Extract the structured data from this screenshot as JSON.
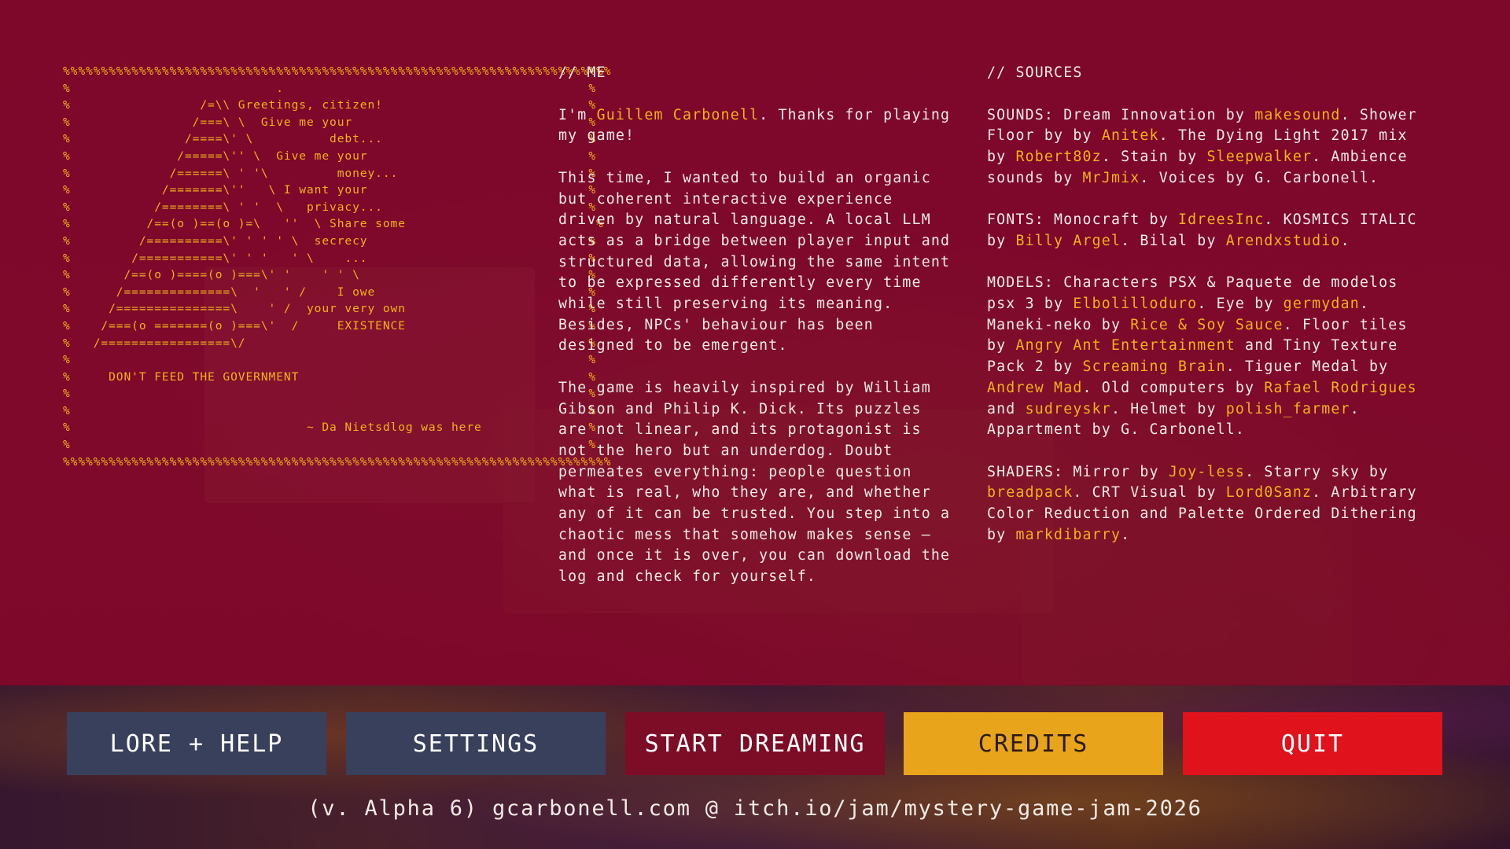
{
  "ascii_art": "%%%%%%%%%%%%%%%%%%%%%%%%%%%%%%%%%%%%%%%%%%%%%%%%%%%%%%%%%%%%%%%%%%%%%%%%\n%                           .                                        %\n%                 /=\\\\ Greetings, citizen!                           %\n%                /===\\ \\  Give me your                               %\n%               /====\\' \\          debt...                           %\n%              /=====\\'' \\  Give me your                             %\n%             /======\\ ' '\\         money...                         %\n%            /=======\\''   \\ I want your                             %\n%           /========\\ ' '  \\   privacy...                           %\n%          /==(o )==(o )=\\   ''  \\ Share some                         %\n%         /==========\\' ' ' ' \\  secrecy                             %\n%        /===========\\' ' '   ' \\    ...                             %\n%       /==(o )====(o )===\\' '    ' ' \\                              %\n%      /==============\\  '   ' /    I owe                            %\n%     /===============\\    ' /  your very own                        %\n%    /===(o =======(o )===\\'  /     EXISTENCE                        %\n%   /=================\\/                                             %\n%                                                                    %\n%     DON'T FEED THE GOVERNMENT                                      %\n%                                                                    %\n%                                                                    %\n%                               ~ Da Nietsdlog was here              %\n%                                                                    %\n%%%%%%%%%%%%%%%%%%%%%%%%%%%%%%%%%%%%%%%%%%%%%%%%%%%%%%%%%%%%%%%%%%%%%%%%",
  "me": {
    "heading": "// ME",
    "p1": {
      "a": "I'm ",
      "name": "Guillem Carbonell",
      "b": ". Thanks for playing my game!"
    },
    "p2": "This time, I wanted to build an organic but coherent interactive experience driven by natural language. A local LLM acts as a bridge between player input and structured data, allowing the same intent to be expressed differently every time while still preserving its meaning. Besides, NPCs' behaviour has been designed to be emergent.",
    "p3": "The game is heavily inspired by William Gibson and Philip K. Dick. Its puzzles are not linear, and its protagonist is not the hero but an underdog. Doubt permeates everything: people question what is real, who they are, and whether any of it can be trusted. You step into a chaotic mess that somehow makes sense — and once it is over, you can download the log and check for yourself."
  },
  "sources": {
    "heading": "// SOURCES",
    "sounds": {
      "t1": "SOUNDS: Dream Innovation by ",
      "l1": "makesound",
      "t2": ". Shower Floor by by ",
      "l2": "Anitek",
      "t3": ". The Dying Light 2017 mix by ",
      "l3": "Robert80z",
      "t4": ". Stain by ",
      "l4": "Sleepwalker",
      "t5": ". Ambience sounds by ",
      "l5": "MrJmix",
      "t6": ". Voices by G. Carbonell."
    },
    "fonts": {
      "t1": "FONTS: Monocraft by ",
      "l1": "IdreesInc",
      "t2": ". KOSMICS ITALIC by ",
      "l2": "Billy Argel",
      "t3": ". Bilal by ",
      "l3": "Arendxstudio",
      "t4": "."
    },
    "models": {
      "t1": "MODELS: Characters PSX & Paquete de modelos psx 3 by ",
      "l1": "Elbolilloduro",
      "t2": ". Eye by ",
      "l2": "germydan",
      "t3": ". Maneki-neko by ",
      "l3": "Rice & Soy Sauce",
      "t4": ". Floor tiles by ",
      "l4": "Angry Ant Entertainment",
      "t5": " and Tiny Texture Pack 2 by ",
      "l5": "Screaming Brain",
      "t6": ". Tiguer Medal by ",
      "l6": "Andrew Mad",
      "t7": ". Old computers by ",
      "l7": "Rafael Rodrigues",
      "t8": " and ",
      "l8": "sudreyskr",
      "t9": ". Helmet by ",
      "l9": "polish_farmer",
      "t10": ". Appartment by G. Carbonell."
    },
    "shaders": {
      "t1": "SHADERS: Mirror by ",
      "l1": "Joy-less",
      "t2": ". Starry sky by ",
      "l2": "breadpack",
      "t3": ". CRT Visual by ",
      "l3": "Lord0Sanz",
      "t4": ". Arbitrary Color Reduction and Palette Ordered Dithering by ",
      "l4": "markdibarry",
      "t5": "."
    }
  },
  "menu": {
    "lore": "LORE + HELP",
    "settings": "SETTINGS",
    "start": "START DREAMING",
    "credits": "CREDITS",
    "quit": "QUIT"
  },
  "footer": "(v. Alpha 6) gcarbonell.com @ itch.io/jam/mystery-game-jam-2026",
  "colors": {
    "background": "#7d082a",
    "text": "#f3ece6",
    "highlight": "#f2b21c",
    "button_default": "#39405c",
    "button_start": "#7d0d26",
    "button_credits": "#e8a41b",
    "button_quit": "#e0121c"
  }
}
